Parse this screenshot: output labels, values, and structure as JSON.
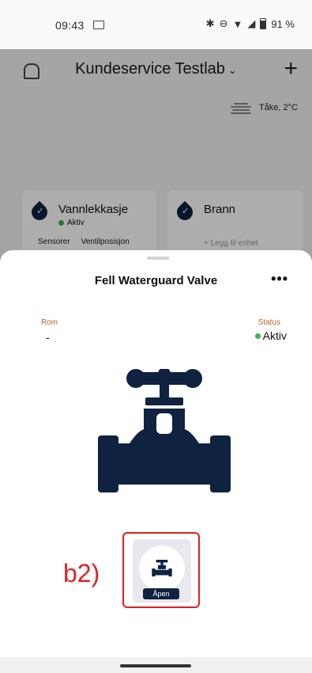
{
  "status_bar": {
    "time": "09:43",
    "battery": "91 %"
  },
  "background_app": {
    "title": "Kundeservice Testlab",
    "weather": "Tåke, 2°C",
    "cards": [
      {
        "title": "Vannlekkasje",
        "status": "Aktiv",
        "tabs": [
          "Sensorer",
          "Ventilposisjon"
        ]
      },
      {
        "title": "Brann",
        "link": "+ Legg til enhet"
      }
    ]
  },
  "sheet": {
    "title": "Fell Waterguard Valve",
    "more_label": "•••",
    "room_label": "Rom",
    "room_value": "-",
    "status_label": "Status",
    "status_value": "Aktiv",
    "valve_tile_label": "Åpen"
  },
  "annotation": "b2)",
  "colors": {
    "navy": "#0f2240",
    "status_green": "#3fb24f",
    "label_orange": "#b5642a",
    "annotation_red": "#e02020"
  }
}
